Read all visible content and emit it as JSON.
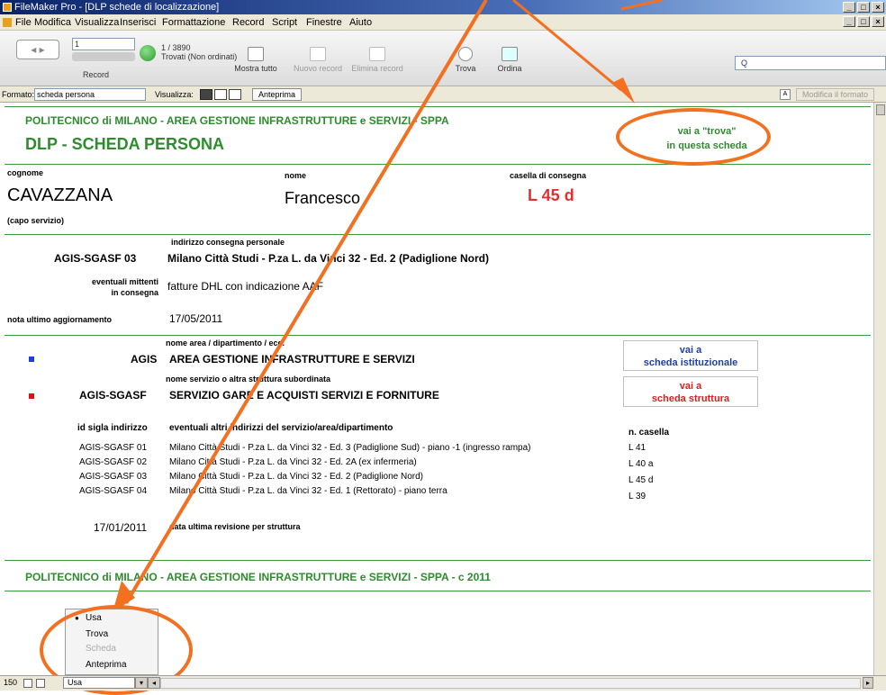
{
  "window": {
    "title": "FileMaker Pro - [DLP schede di localizzazione]",
    "controls": [
      "_",
      "□",
      "×"
    ]
  },
  "menubar": [
    "File",
    "Modifica",
    "Visualizza",
    "Inserisci",
    "Formattazione",
    "Record",
    "Script",
    "Finestre",
    "Aiuto"
  ],
  "toolbar": {
    "record_number": "1",
    "record_label": "Record",
    "found_count": "1 / 3890",
    "found_status": "Trovati (Non ordinati)",
    "buttons": {
      "show_all": "Mostra tutto",
      "new_record": "Nuovo record",
      "delete_record": "Elimina record",
      "find": "Trova",
      "sort": "Ordina"
    },
    "search_placeholder": "Q"
  },
  "formatbar": {
    "format_label": "Formato:",
    "format_value": "scheda persona",
    "view_label": "Visualizza:",
    "preview": "Anteprima",
    "edit_layout": "Modifica il formato"
  },
  "record": {
    "header_org": "POLITECNICO di MILANO - AREA GESTIONE INFRASTRUTTURE e SERVIZI - SPPA",
    "header_title": "DLP - SCHEDA PERSONA",
    "find_link_line1": "vai a \"trova\"",
    "find_link_line2": "in questa scheda",
    "surname_label": "cognome",
    "surname": "CAVAZZANA",
    "name_label": "nome",
    "name": "Francesco",
    "mailbox_label": "casella di consegna",
    "mailbox": "L 45 d",
    "role": "(capo servizio)",
    "address_label": "indirizzo consegna personale",
    "address_code": "AGIS-SGASF 03",
    "address": "Milano Città Studi - P.za L. da Vinci 32  - Ed. 2 (Padiglione Nord)",
    "senders_label_1": "eventuali mittenti",
    "senders_label_2": "in consegna",
    "senders": "fatture DHL con indicazione AAF",
    "last_update_label": "nota ultimo aggiornamento",
    "last_update": "17/05/2011",
    "area_label": "nome area / dipartimento / ecc.",
    "area_code": "AGIS",
    "area_name": "AREA GESTIONE INFRASTRUTTURE E SERVIZI",
    "institutional_link_1": "vai a",
    "institutional_link_2": "scheda istituzionale",
    "service_label": "nome servizio o altra struttura subordinata",
    "service_code": "AGIS-SGASF",
    "service_name": "SERVIZIO GARE E ACQUISTI SERVIZI E FORNITURE",
    "structure_link_1": "vai a",
    "structure_link_2": "scheda struttura",
    "addr_table": {
      "col_id": "id sigla indirizzo",
      "col_addr": "eventuali altri indirizzi del servizio/area/dipartimento",
      "col_box": "n. casella",
      "rows": [
        {
          "id": "AGIS-SGASF 01",
          "addr": "Milano Città Studi - P.za L. da Vinci 32  - Ed. 3 (Padiglione Sud) - piano -1 (ingresso rampa)",
          "box": "L 41"
        },
        {
          "id": "AGIS-SGASF 02",
          "addr": "Milano Città Studi - P.za L. da Vinci 32  - Ed. 2A (ex infermeria)",
          "box": "L 40 a"
        },
        {
          "id": "AGIS-SGASF 03",
          "addr": "Milano Città Studi - P.za L. da Vinci 32  - Ed. 2 (Padiglione Nord)",
          "box": "L 45 d"
        },
        {
          "id": "AGIS-SGASF 04",
          "addr": "Milano Città Studi - P.za L. da Vinci 32  - Ed. 1 (Rettorato) - piano terra",
          "box": "L 39"
        }
      ]
    },
    "revision_date": "17/01/2011",
    "revision_label": "data ultima revisione per struttura",
    "footer": "POLITECNICO di MILANO - AREA GESTIONE INFRASTRUTTURE e SERVIZI - SPPA -  c 2011"
  },
  "popup_menu": {
    "items": [
      "Usa",
      "Trova",
      "Scheda",
      "Anteprima"
    ]
  },
  "statusbar": {
    "zoom": "150",
    "mode": "Usa"
  },
  "colors": {
    "accent_green": "#2e8b2e",
    "mailbox_red": "#e03030",
    "annotation_orange": "#f37021",
    "area_blue": "#1e3ed8",
    "service_red": "#e01010",
    "link_blue": "#1f3f9f",
    "link_red": "#d82020"
  }
}
